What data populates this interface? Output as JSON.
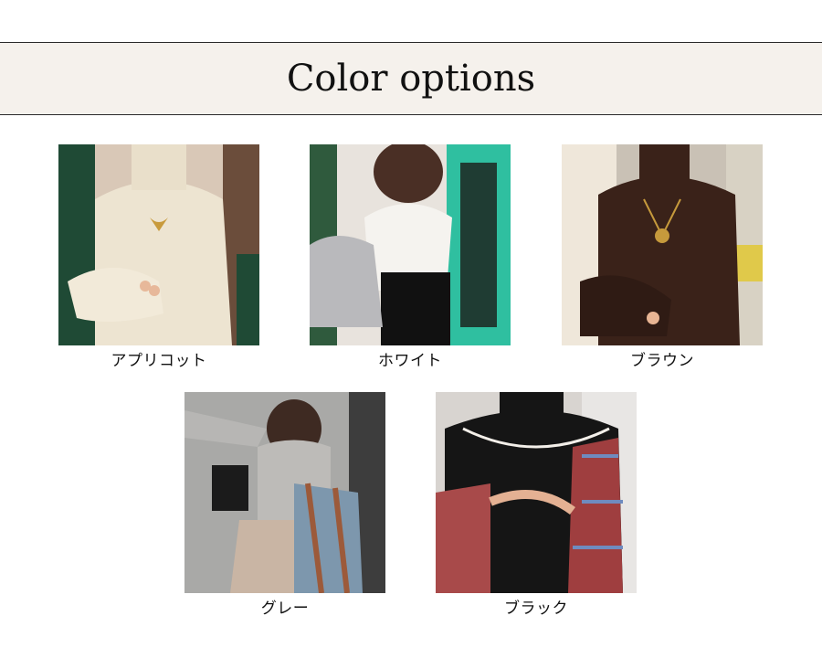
{
  "header": {
    "title": "Color options"
  },
  "colors": [
    {
      "label": "アプリコット",
      "swatch": "#ece4d0"
    },
    {
      "label": "ホワイト",
      "swatch": "#f4f2ee"
    },
    {
      "label": "ブラウン",
      "swatch": "#3b231b"
    },
    {
      "label": "グレー",
      "swatch": "#b9b8b6"
    },
    {
      "label": "ブラック",
      "swatch": "#141414"
    }
  ]
}
